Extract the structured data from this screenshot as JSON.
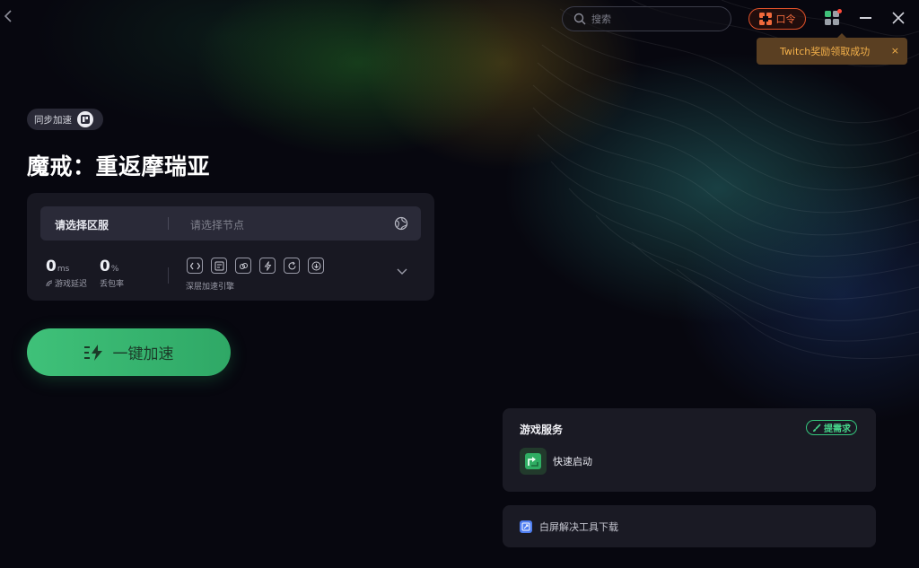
{
  "topbar": {
    "search_placeholder": "搜索",
    "command_label": "口令"
  },
  "toast": {
    "message": "Twitch奖励领取成功",
    "close": "×"
  },
  "game": {
    "sync_label": "同步加速",
    "title": "魔戒：重返摩瑞亚"
  },
  "selector": {
    "region": "请选择区服",
    "node_placeholder": "请选择节点"
  },
  "stats": {
    "latency_value": "0",
    "latency_unit": "ms",
    "latency_label": "游戏延迟",
    "loss_value": "0",
    "loss_unit": "%",
    "loss_label": "丢包率",
    "engine_label": "深层加速引擎"
  },
  "boost": {
    "label": "一键加速"
  },
  "services": {
    "title": "游戏服务",
    "request_label": "提需求",
    "quick_launch": "快速启动"
  },
  "tool": {
    "label": "白屏解决工具下载"
  },
  "colors": {
    "accent_green": "#3fc179",
    "command_orange": "#e0512a",
    "toast_bg": "#5a3f22",
    "toast_text": "#f3b04a"
  }
}
